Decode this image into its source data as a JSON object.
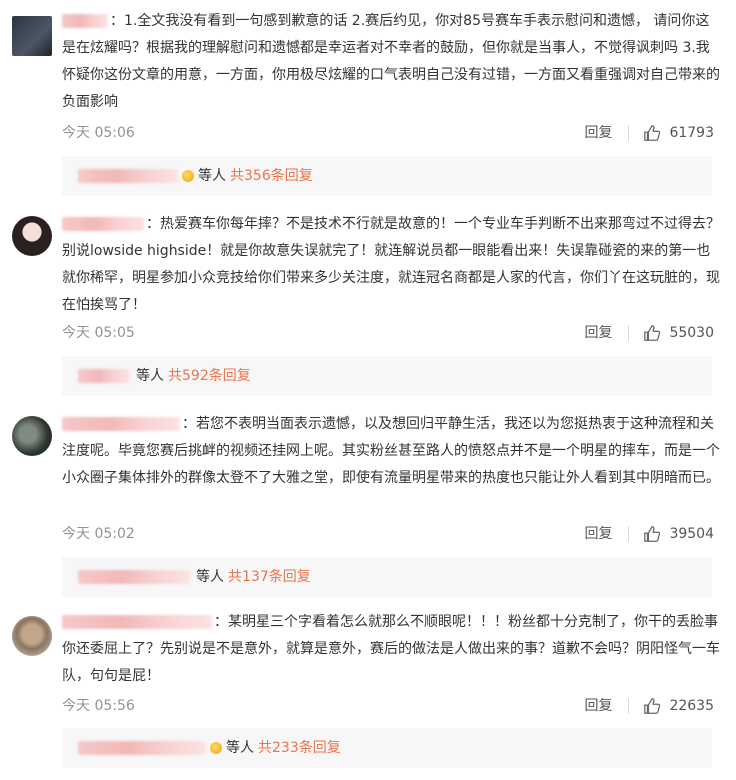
{
  "comments": [
    {
      "text": "：1.全文我没有看到一句感到歉意的话 2.赛后约见，你对85号赛车手表示慰问和遗憾， 请问你这是在炫耀吗？根据我的理解慰问和遗憾都是幸运者对不幸者的鼓励，但你就是当事人，不觉得讽刺吗 3.我怀疑你这份文章的用意，一方面，你用极尽炫耀的口气表明自己没有过错，一方面又看重强调对自己带来的负面影响",
      "time": "今天 05:06",
      "reply": "回复",
      "likes": "61793",
      "sub_label": "等人",
      "sub_count": "共356条回复"
    },
    {
      "text": "：热爱赛车你每年摔？不是技术不行就是故意的！一个专业车手判断不出来那弯过不过得去？别说lowside highside！就是你故意失误就完了！就连解说员都一眼能看出来！失误靠碰瓷的来的第一也就你稀罕，明星参加小众竞技给你们带来多少关注度，就连冠名商都是人家的代言，你们丫在这玩脏的，现在怕挨骂了！",
      "time": "今天 05:05",
      "reply": "回复",
      "likes": "55030",
      "sub_label": "等人",
      "sub_count": "共592条回复"
    },
    {
      "text": "：若您不表明当面表示遗憾，以及想回归平静生活，我还以为您挺热衷于这种流程和关注度呢。毕竟您赛后挑衅的视频还挂网上呢。其实粉丝甚至路人的愤怒点并不是一个明星的摔车，而是一个小众圈子集体排外的群像太登不了大雅之堂，即使有流量明星带来的热度也只能让外人看到其中阴暗而已。",
      "time": "今天 05:02",
      "reply": "回复",
      "likes": "39504",
      "sub_label": "等人",
      "sub_count": "共137条回复"
    },
    {
      "text": "：某明星三个字看着怎么就那么不顺眼呢！！！粉丝都十分克制了，你干的丢脸事你还委屈上了？先别说是不是意外，就算是意外，赛后的做法是人做出来的事？道歉不会吗？阴阳怪气一车队，句句是屁！",
      "time": "今天 05:56",
      "reply": "回复",
      "likes": "22635",
      "sub_label": "等人",
      "sub_count": "共233条回复"
    }
  ]
}
